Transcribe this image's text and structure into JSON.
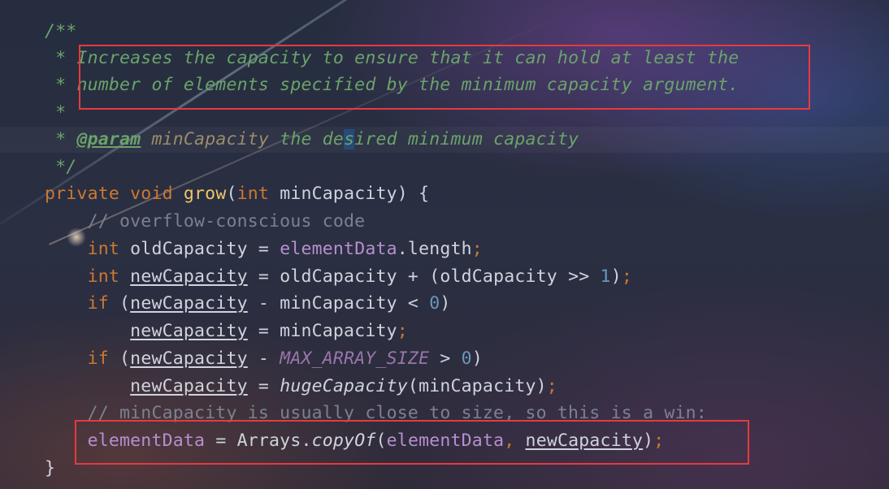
{
  "code": {
    "l1": "/**",
    "l2_star": " * ",
    "l2_text": "Increases the capacity to ensure that it can hold at least the",
    "l3_star": " * ",
    "l3_text": "number of elements specified by the minimum capacity argument.",
    "l4": " *",
    "l5_star": " * ",
    "l5_tag": "@param",
    "l5_sp": " ",
    "l5_name": "minCapacity",
    "l5_desc_a": " the de",
    "l5_desc_b": "s",
    "l5_desc_c": "ired minimum capacity",
    "l6": " */",
    "l7_private": "private",
    "l7_void": " void ",
    "l7_grow": "grow",
    "l7_open": "(",
    "l7_int": "int",
    "l7_rest": " minCapacity) {",
    "l8": "    // overflow-conscious code",
    "l9_int": "    int",
    "l9_a": " oldCapacity = ",
    "l9_field": "elementData",
    "l9_b": ".length",
    "l9_semi": ";",
    "l10_int": "    int",
    "l10_sp": " ",
    "l10_var": "newCapacity",
    "l10_a": " = oldCapacity + (oldCapacity >> ",
    "l10_num": "1",
    "l10_b": ")",
    "l10_semi": ";",
    "l11_if": "    if",
    "l11_a": " (",
    "l11_var": "newCapacity",
    "l11_b": " - minCapacity < ",
    "l11_num": "0",
    "l11_c": ")",
    "l12_ind": "        ",
    "l12_var": "newCapacity",
    "l12_a": " = minCapacity",
    "l12_semi": ";",
    "l13_if": "    if",
    "l13_a": " (",
    "l13_var": "newCapacity",
    "l13_b": " - ",
    "l13_const": "MAX_ARRAY_SIZE",
    "l13_c": " > ",
    "l13_num": "0",
    "l13_d": ")",
    "l14_ind": "        ",
    "l14_var": "newCapacity",
    "l14_a": " = ",
    "l14_fn": "hugeCapacity",
    "l14_b": "(minCapacity)",
    "l14_semi": ";",
    "l15": "    // minCapacity is usually close to size, so this is a win:",
    "l16_ind": "    ",
    "l16_field": "elementData",
    "l16_a": " = Arrays.",
    "l16_fn": "copyOf",
    "l16_b": "(",
    "l16_field2": "elementData",
    "l16_comma": ", ",
    "l16_var": "newCapacity",
    "l16_c": ")",
    "l16_semi": ";",
    "l17": "}"
  },
  "colors": {
    "comment": "#6aa36a",
    "keyword": "#cc7832",
    "function": "#f0c466",
    "field": "#b78fd0",
    "number": "#6897bb",
    "highlight_box": "#e8393e"
  }
}
